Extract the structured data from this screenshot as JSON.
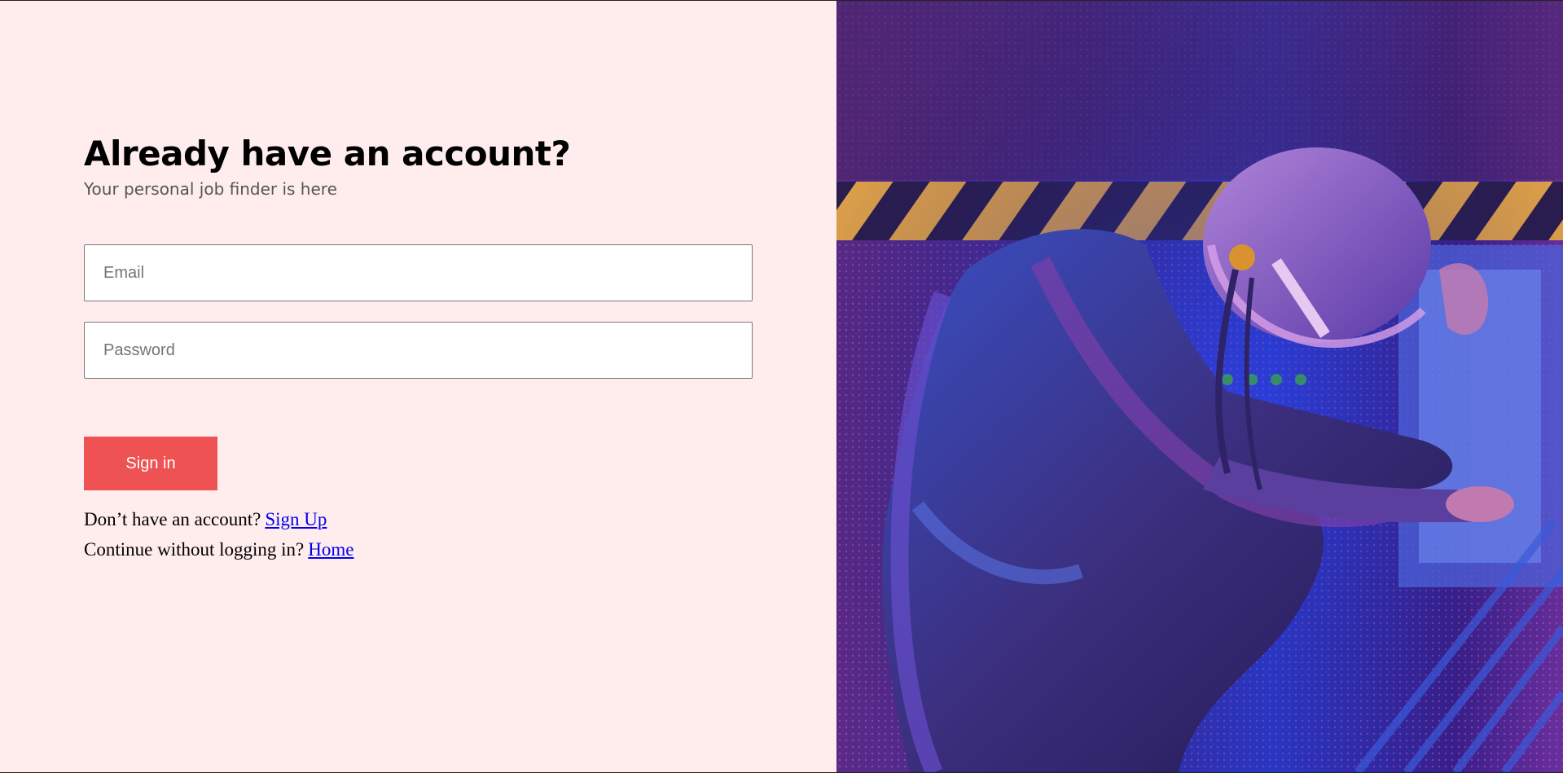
{
  "login": {
    "title": "Already have an account?",
    "subtitle": "Your personal job finder is here",
    "email_placeholder": "Email",
    "password_placeholder": "Password",
    "signin_label": "Sign in",
    "signup_prompt": "Don’t have an account?",
    "signup_link": "Sign Up",
    "guest_prompt": "Continue without logging in?",
    "home_link": "Home"
  },
  "hero": {
    "icon": "astronaut-photo",
    "alt": "Astronaut in spacesuit working at a control panel under blue and purple light"
  },
  "colors": {
    "panel_bg": "#ffeded",
    "accent": "#ee5253",
    "link": "#0000ee"
  }
}
